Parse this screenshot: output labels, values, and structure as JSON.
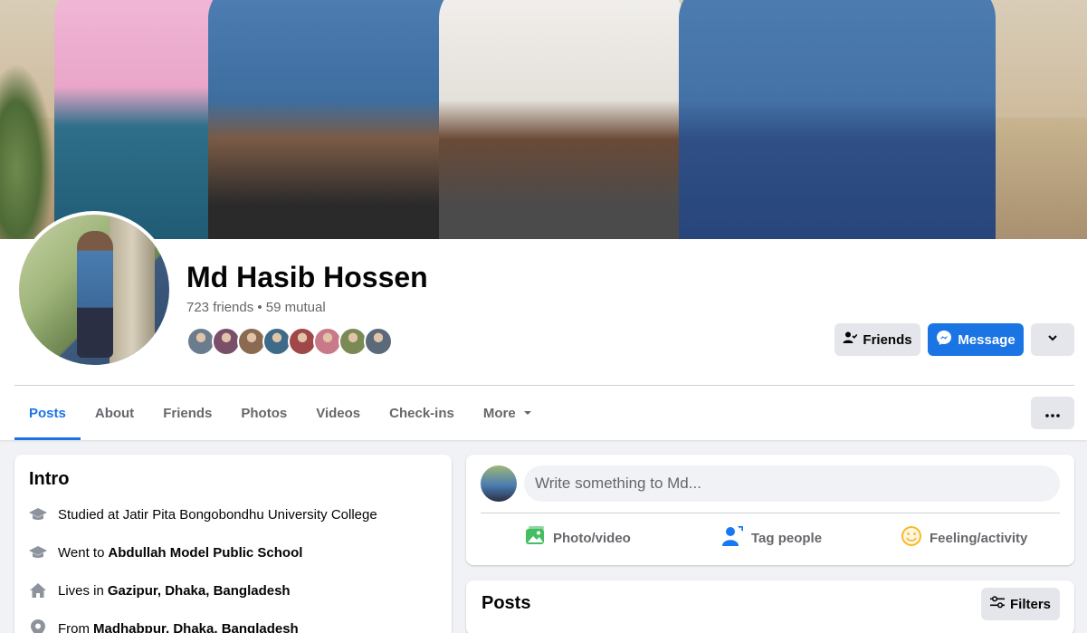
{
  "profile": {
    "name": "Md Hasib Hossen",
    "friends_line": "723 friends • 59 mutual",
    "mutual_face_colors": [
      "#6b7c8f",
      "#7a4f6a",
      "#8a6b52",
      "#3f6b8a",
      "#a04848",
      "#c97a8a",
      "#7b8a55",
      "#5a6a7a"
    ]
  },
  "actions": {
    "friends_label": "Friends",
    "message_label": "Message"
  },
  "tabs": [
    {
      "label": "Posts",
      "active": true
    },
    {
      "label": "About"
    },
    {
      "label": "Friends"
    },
    {
      "label": "Photos"
    },
    {
      "label": "Videos"
    },
    {
      "label": "Check-ins"
    },
    {
      "label": "More"
    }
  ],
  "intro": {
    "title": "Intro",
    "rows": [
      {
        "icon": "graduation-cap-icon",
        "text": "Studied at Jatir Pita Bongobondhu University College",
        "bold": ""
      },
      {
        "icon": "graduation-cap-icon",
        "text": "Went to",
        "bold": "Abdullah Model Public School"
      },
      {
        "icon": "home-icon",
        "text": "Lives in",
        "bold": "Gazipur, Dhaka, Bangladesh"
      },
      {
        "icon": "location-pin-icon",
        "text": "From",
        "bold": "Madhabpur, Dhaka, Bangladesh"
      }
    ]
  },
  "composer": {
    "placeholder": "Write something to Md...",
    "photo_label": "Photo/video",
    "tag_label": "Tag people",
    "feeling_label": "Feeling/activity"
  },
  "posts": {
    "title": "Posts",
    "filters_label": "Filters"
  },
  "colors": {
    "accent": "#1b74e4",
    "photo_green": "#45bd62",
    "tag_blue": "#1877f2",
    "feeling_yellow": "#f7b928"
  }
}
